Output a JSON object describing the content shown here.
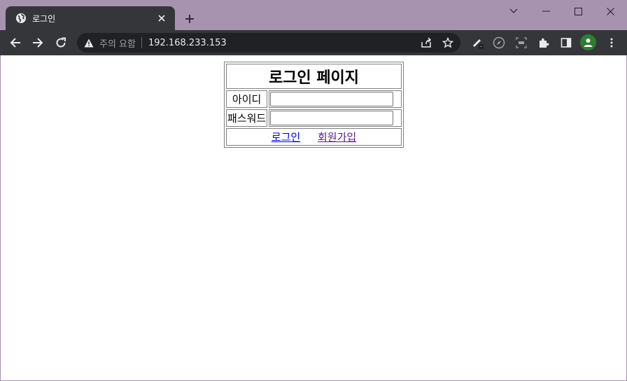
{
  "browser": {
    "tab_title": "로그인",
    "address": {
      "security_label": "주의 요함",
      "url": "192.168.233.153"
    }
  },
  "page": {
    "heading": "로그인 페이지",
    "fields": {
      "id_label": "아이디",
      "password_label": "패스워드"
    },
    "links": {
      "login": "로그인",
      "signup": "회원가입"
    }
  },
  "colors": {
    "frame": "#a793b0",
    "toolbar": "#35363a",
    "link": "#0000ee",
    "visited_link": "#551a8b",
    "avatar": "#2e7d32"
  }
}
